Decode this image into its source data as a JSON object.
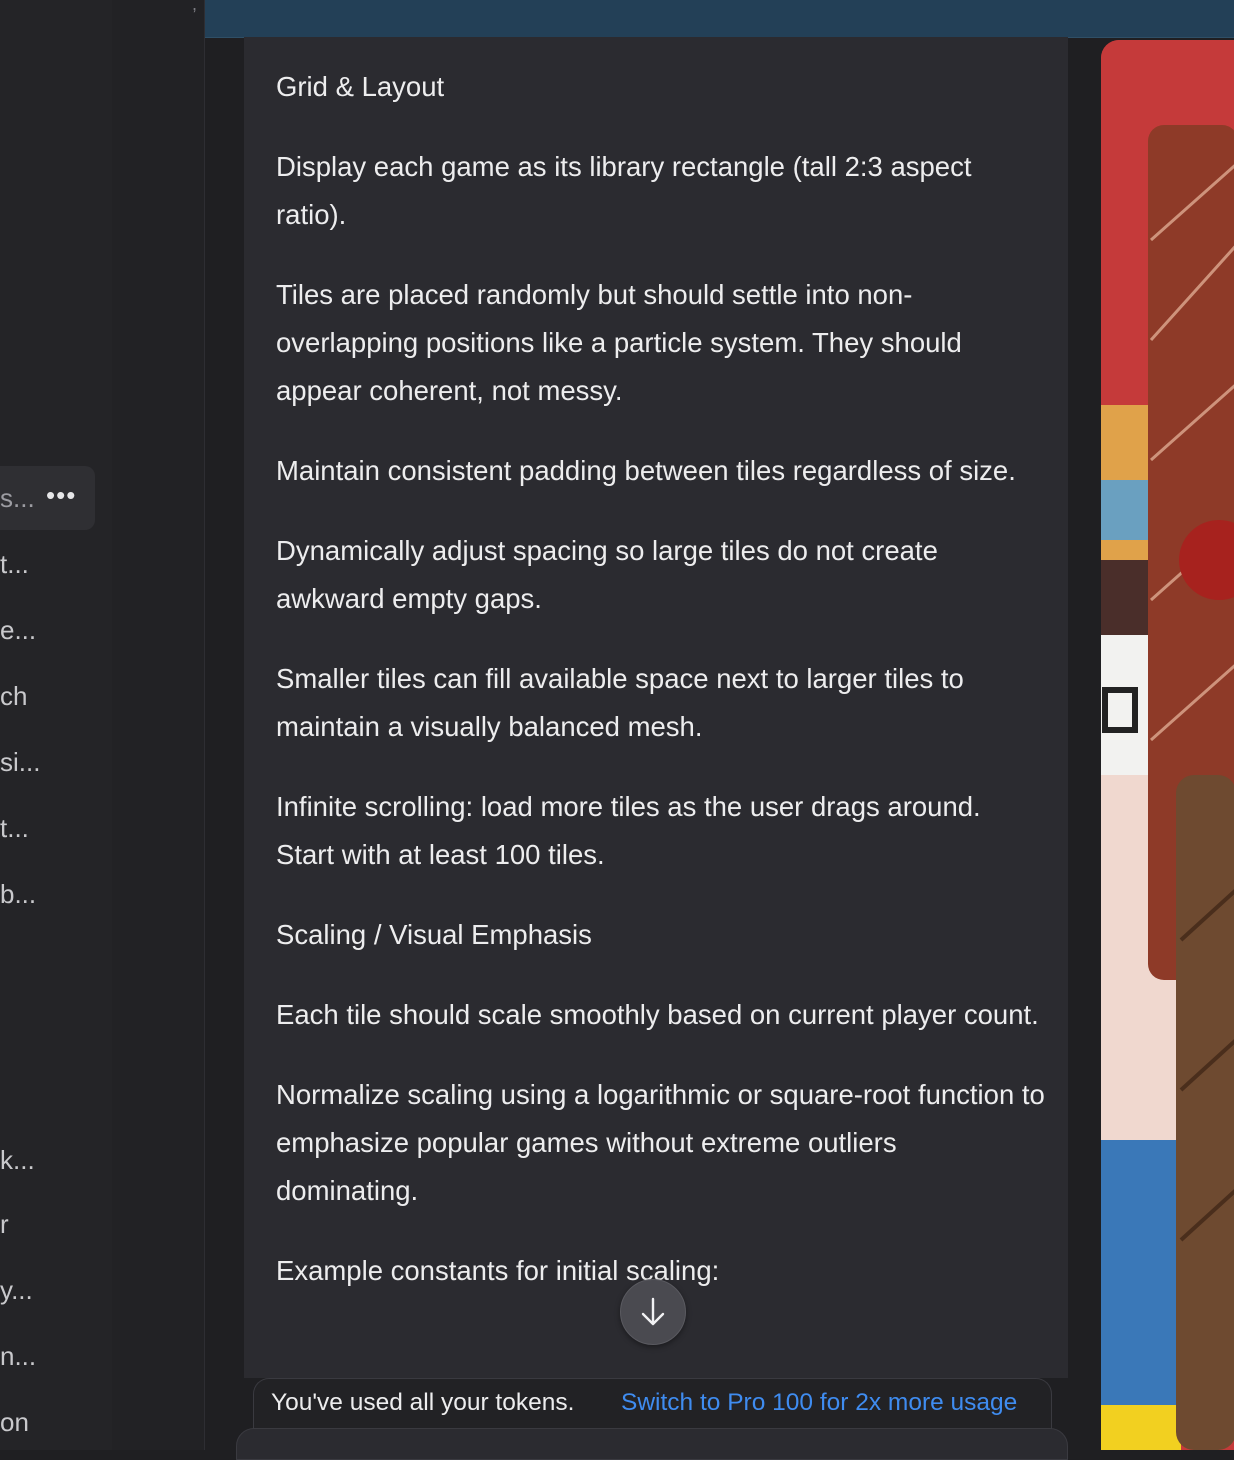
{
  "sidebar": {
    "top_glyph": ",",
    "active_item_label": "s...",
    "more_label": "•••",
    "items": [
      {
        "label": "t..."
      },
      {
        "label": "e..."
      },
      {
        "label": "ch"
      },
      {
        "label": "si..."
      },
      {
        "label": "t..."
      },
      {
        "label": "b..."
      },
      {
        "label": "k..."
      },
      {
        "label": "r"
      },
      {
        "label": "y..."
      },
      {
        "label": "n..."
      },
      {
        "label": "on"
      }
    ]
  },
  "message": {
    "paragraphs": [
      "Grid & Layout",
      "Display each game as its library rectangle (tall 2:3 aspect ratio).",
      "Tiles are placed randomly but should settle into non-overlapping positions like a particle system. They should appear coherent, not messy.",
      "Maintain consistent padding between tiles regardless of size.",
      "Dynamically adjust spacing so large tiles do not create awkward empty gaps.",
      "Smaller tiles can fill available space next to larger tiles to maintain a visually balanced mesh.",
      "Infinite scrolling: load more tiles as the user drags around. Start with at least 100 tiles.",
      "Scaling / Visual Emphasis",
      "Each tile should scale smoothly based on current player count.",
      "Normalize scaling using a logarithmic or square-root function to emphasize popular games without extreme outliers dominating.",
      "Example constants for initial scaling:"
    ]
  },
  "usage": {
    "text": "You've used all your tokens.",
    "link": "Switch to Pro 100 for 2x more usage"
  },
  "icons": {
    "scroll_down": "arrow-down-icon"
  },
  "colors": {
    "topbar": "#234057",
    "panel": "#2b2b30",
    "link": "#3f8cf0"
  }
}
